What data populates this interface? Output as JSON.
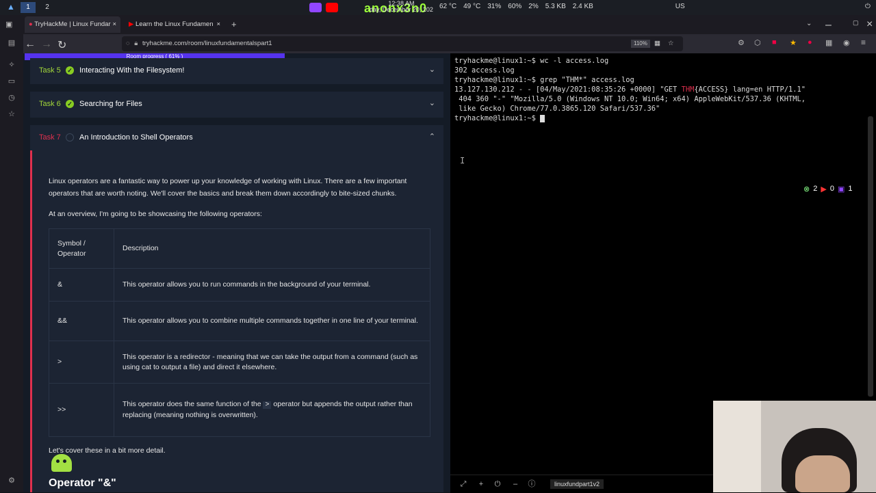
{
  "system_bar": {
    "workspaces": [
      "1",
      "2"
    ],
    "clock": "12:38 AM",
    "date": "day, December 20, 202",
    "streamer": "anonx3n0",
    "stats": [
      "62 °C",
      "49 °C",
      "31%",
      "60%",
      "2%",
      "5.3 KB",
      "2.4 KB",
      "US"
    ]
  },
  "tabs": [
    {
      "label": "TryHackMe | Linux Fundar",
      "close": "×"
    },
    {
      "label": "Learn the Linux Fundamen",
      "close": "×"
    }
  ],
  "new_tab": "+",
  "url": "tryhackme.com/room/linuxfundamentalspart1",
  "zoom": "110%",
  "progress_label": "Room progress ( 61% )",
  "progress_value": 61,
  "tasks": [
    {
      "num": "Task 5",
      "title": "Interacting With the Filesystem!",
      "done": true
    },
    {
      "num": "Task 6",
      "title": "Searching for Files",
      "done": true
    },
    {
      "num": "Task 7",
      "title": "An Introduction to Shell Operators",
      "done": false
    }
  ],
  "intro": "Linux operators are a fantastic way to power up your knowledge of working with Linux. There are a few important operators that are worth noting. We'll cover the basics and break them down accordingly to bite-sized chunks.",
  "overview": "At an overview, I'm going to be showcasing the following operators:",
  "table": {
    "header": [
      "Symbol / Operator",
      "Description"
    ],
    "rows": [
      {
        "symbol": "&",
        "desc": "This operator allows you to run commands in the background of your terminal."
      },
      {
        "symbol": "&&",
        "desc": "This operator allows you to combine multiple commands together in one line of your terminal."
      },
      {
        "symbol": ">",
        "desc": "This operator is a redirector - meaning that we can take the output from a command (such as using cat to output a file) and direct it elsewhere."
      },
      {
        "symbol": ">>",
        "desc_pre": "This operator does the same function of the ",
        "desc_code": ">",
        "desc_post": " operator but appends the output rather than replacing (meaning nothing is overwritten)."
      }
    ]
  },
  "cover_text": "Let's cover these in a bit more detail.",
  "operator_heading": "Operator \"&\"",
  "terminal": {
    "lines": [
      "tryhackme@linux1:~$ wc -l access.log",
      "302 access.log",
      "tryhackme@linux1:~$ grep \"THM*\" access.log",
      "13.127.130.212 - - [04/May/2021:08:35:26 +0000] \"GET THM{ACCESS} lang=en HTTP/1.1\"",
      " 404 360 \"-\" \"Mozilla/5.0 (Windows NT 10.0; Win64; x64) AppleWebKit/537.36 (KHTML,",
      " like Gecko) Chrome/77.0.3865.120 Safari/537.36\"",
      "tryhackme@linux1:~$ "
    ],
    "tab_name": "linuxfundpart1v2"
  },
  "counters": [
    "2",
    "0",
    "1"
  ],
  "colors": {
    "accent": "#a2d63a",
    "progress": "#5533ee",
    "task_border": "#e0304e",
    "thm_highlight": "#e0304e"
  }
}
